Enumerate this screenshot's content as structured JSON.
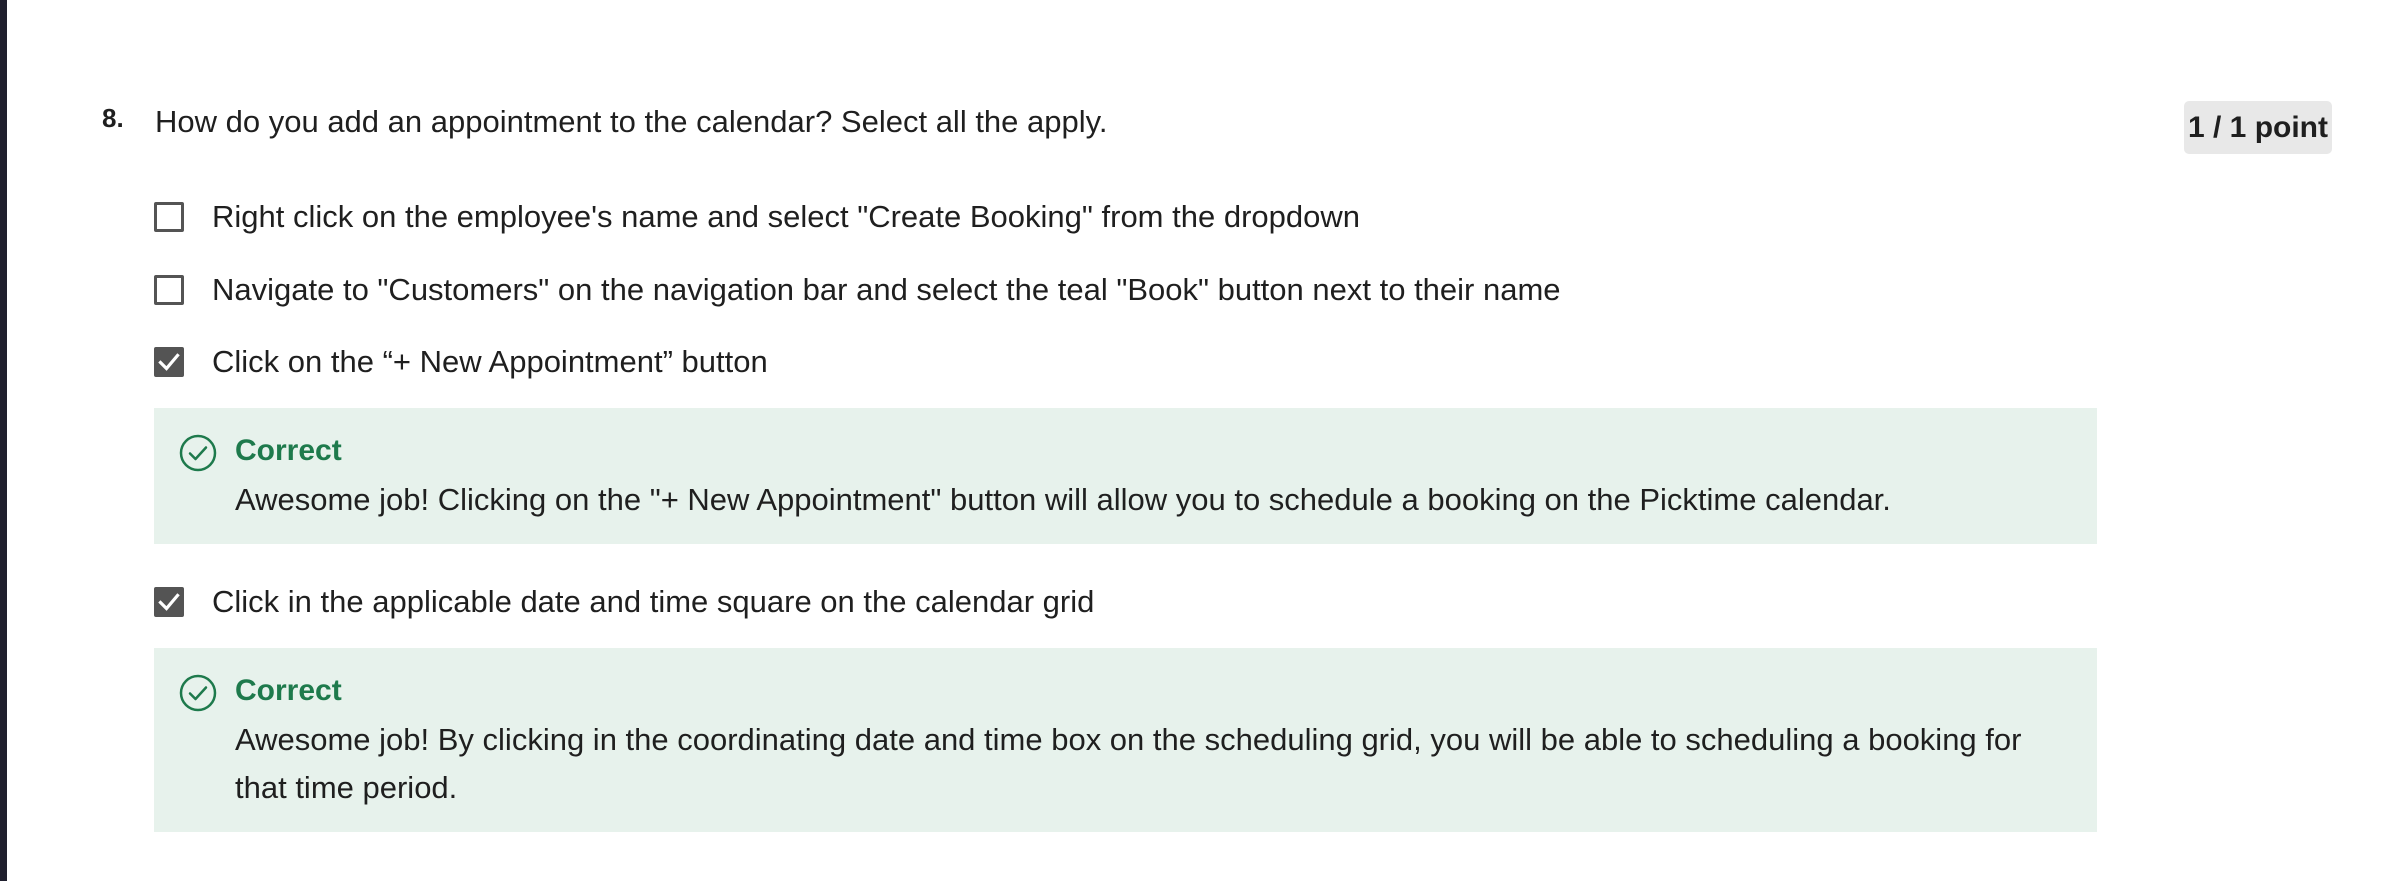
{
  "question": {
    "number": "8.",
    "text": "How do you add an appointment to the calendar? Select all the apply.",
    "points": "1 / 1 point"
  },
  "options": [
    {
      "label": "Right click on the employee's name and select \"Create Booking\" from the dropdown",
      "checked": false
    },
    {
      "label": "Navigate to \"Customers\" on the navigation bar and select the teal \"Book\" button next to their name",
      "checked": false
    },
    {
      "label": "Click on the “+ New Appointment” button",
      "checked": true,
      "feedback": {
        "status": "Correct",
        "text": "Awesome job! Clicking on the \"+ New Appointment\" button will allow you to schedule a booking on the Picktime calendar."
      }
    },
    {
      "label": "Click in the applicable date and time square on the calendar grid",
      "checked": true,
      "feedback": {
        "status": "Correct",
        "text": "Awesome job! By clicking in the coordinating date and time box on the scheduling grid, you will be able to scheduling a booking for that time period."
      }
    }
  ],
  "colors": {
    "correct": "#1e7a4c",
    "feedback_bg": "#e7f2ec",
    "checkbox": "#545454"
  },
  "icons": {
    "checkmark": "checkmark-icon",
    "correct": "check-circle-icon"
  }
}
